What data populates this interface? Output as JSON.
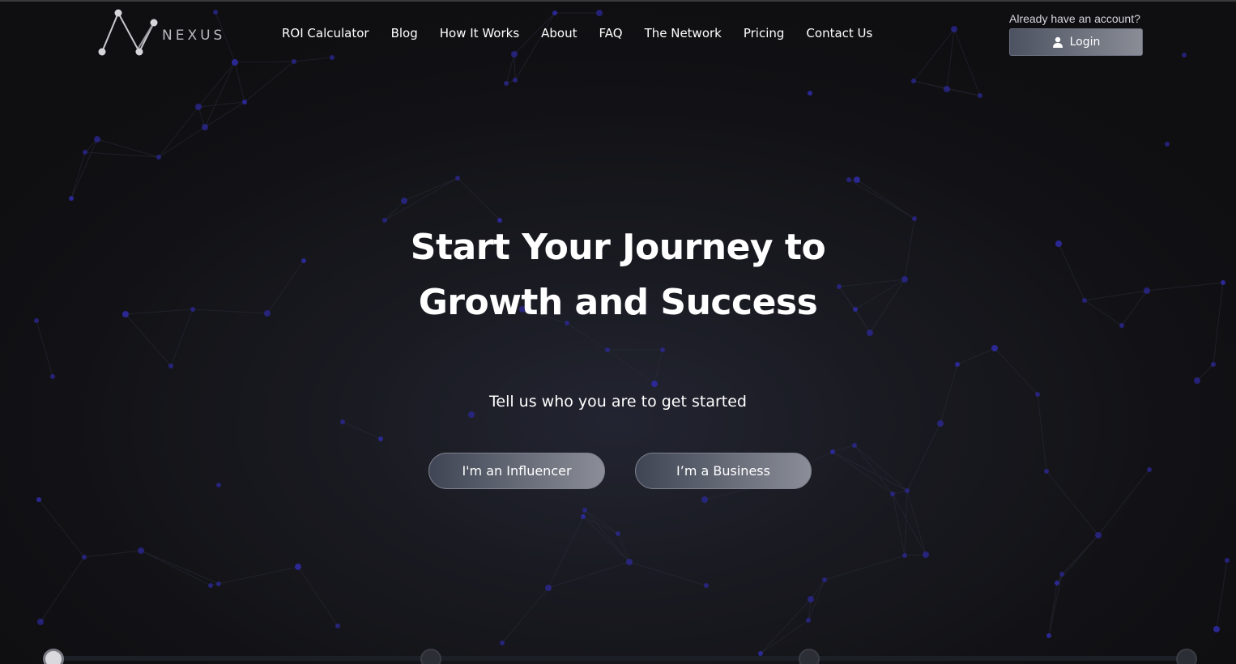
{
  "brand": {
    "name": "NEXUS",
    "logo_icon": "nexus-logo-icon"
  },
  "nav": {
    "items": [
      {
        "label": "ROI Calculator"
      },
      {
        "label": "Blog"
      },
      {
        "label": "How It Works"
      },
      {
        "label": "About"
      },
      {
        "label": "FAQ"
      },
      {
        "label": "The Network"
      },
      {
        "label": "Pricing"
      },
      {
        "label": "Contact Us"
      }
    ]
  },
  "account": {
    "prompt": "Already have an account?",
    "login_label": "Login",
    "login_icon": "user-icon"
  },
  "hero": {
    "title_line1": "Start Your Journey to",
    "title_line2": "Growth and Success",
    "subtitle": "Tell us who you are to get started",
    "influencer_button": "I'm an Influencer",
    "business_button": "I’m a Business"
  },
  "progress": {
    "steps_total": 4,
    "current_step": 1
  },
  "colors": {
    "background": "#111114",
    "network_dot": "#2d2aa0",
    "button_gradient_start": "#3f4554",
    "button_gradient_end": "#8b8e98"
  }
}
